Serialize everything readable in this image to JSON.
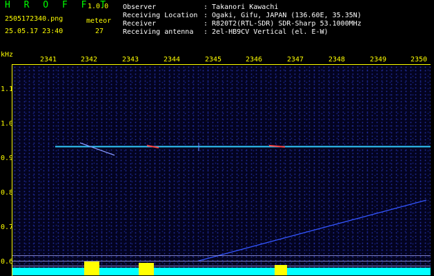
{
  "header": {
    "app_name": "H R O F F T",
    "version": "1.0.0",
    "filename": "2505172340.png",
    "datetime": "25.05.17 23:40",
    "meteor_label": "meteor",
    "meteor_count": "27",
    "fields": [
      {
        "label": "Observer",
        "value": ": Takanori Kawachi"
      },
      {
        "label": "Receiving Location",
        "value": ": Ogaki, Gifu, JAPAN (136.60E, 35.35N)"
      },
      {
        "label": "Receiver",
        "value": ": R820T2(RTL-SDR) SDR-Sharp 53.1000MHz"
      },
      {
        "label": "Receiving antenna",
        "value": ": 2el-HB9CV Vertical (el. E-W)"
      }
    ]
  },
  "axes": {
    "y_unit": "kHz",
    "x_ticks": [
      "2341",
      "2342",
      "2343",
      "2344",
      "2345",
      "2346",
      "2347",
      "2348",
      "2349",
      "2350"
    ],
    "y_ticks": [
      "1.1",
      "1.0",
      "0.9",
      "0.8",
      "0.7",
      "0.6"
    ]
  },
  "colors": {
    "background": "#000000",
    "app_name": "#00ff00",
    "axis": "#ffff00",
    "text": "#ffffff",
    "carrier": "#33ccff",
    "meteor": "#ff3333",
    "histogram": "#00ffff",
    "histogram_peak": "#ffff00"
  }
}
